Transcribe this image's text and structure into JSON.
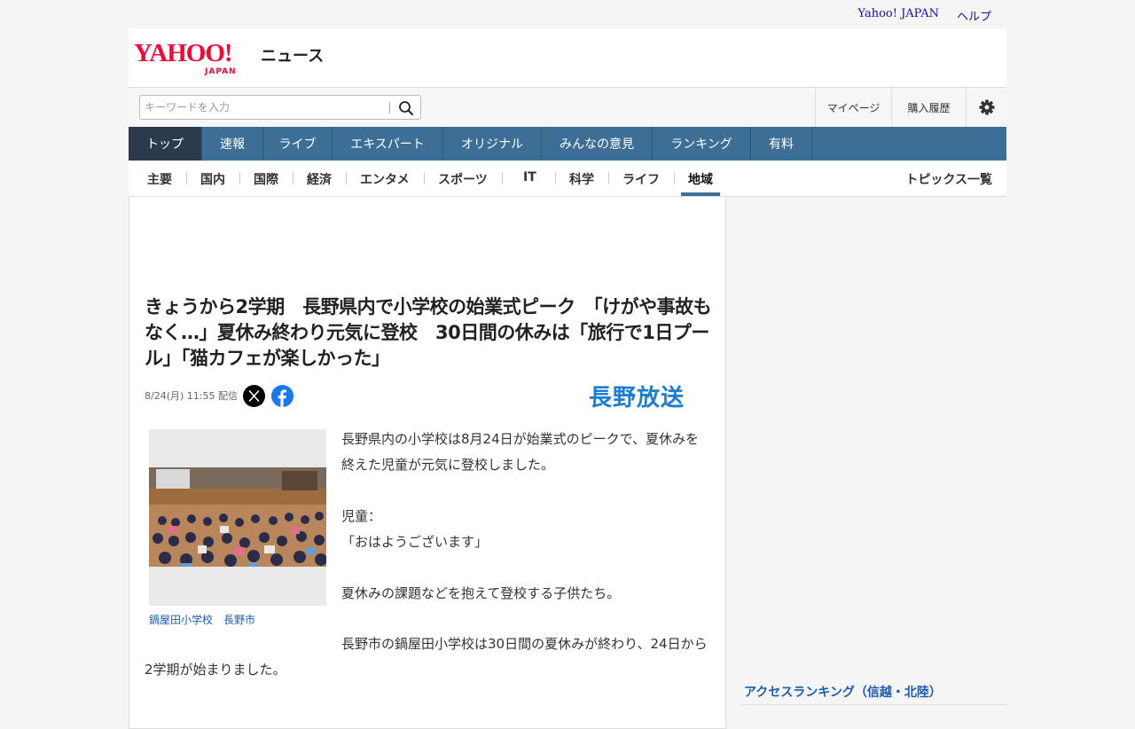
{
  "utility": {
    "yahoo_japan": "Yahoo! JAPAN",
    "help": "ヘルプ"
  },
  "header": {
    "logo_text": "YAHOO!",
    "logo_sub": "JAPAN",
    "section": "ニュース"
  },
  "search": {
    "placeholder": "キーワードを入力",
    "button_icon": "search-icon"
  },
  "account": {
    "mypage": "マイページ",
    "purchase_history": "購入履歴",
    "settings_icon": "gear-icon"
  },
  "main_nav": [
    {
      "label": "トップ",
      "active": true
    },
    {
      "label": "速報"
    },
    {
      "label": "ライブ"
    },
    {
      "label": "エキスパート"
    },
    {
      "label": "オリジナル"
    },
    {
      "label": "みんなの意見"
    },
    {
      "label": "ランキング"
    },
    {
      "label": "有料"
    }
  ],
  "sub_nav": {
    "items": [
      "主要",
      "国内",
      "国際",
      "経済",
      "エンタメ",
      "スポーツ",
      "IT",
      "科学",
      "ライフ",
      "地域"
    ],
    "active": "地域",
    "topics_list": "トピックス一覧"
  },
  "article": {
    "title": "きょうから2学期　長野県内で小学校の始業式ピーク　「けがや事故もなく…」夏休み終わり元気に登校　30日間の休みは「旅行で1日プール」「猫カフェが楽しかった」",
    "date": "8/24(月) 11:55 配信",
    "source": "長野放送",
    "photo_caption": "鍋屋田小学校　長野市",
    "paragraphs": [
      "長野県内の小学校は8月24日が始業式のピークで、夏休みを終えた児童が元気に登校しました。",
      "児童：",
      "「おはようございます」",
      "夏休みの課題などを抱えて登校する子供たち。",
      "長野市の鍋屋田小学校は30日間の夏休みが終わり、24日から2学期が始まりました。"
    ]
  },
  "sidebar": {
    "ranking_title": "アクセスランキング（信越・北陸）"
  },
  "colors": {
    "nav_bg": "#3c6e96",
    "nav_active": "#2b3a4d",
    "yahoo_red": "#ff0033",
    "link_blue": "#1a5bb5",
    "source_blue": "#1a7fd4"
  }
}
